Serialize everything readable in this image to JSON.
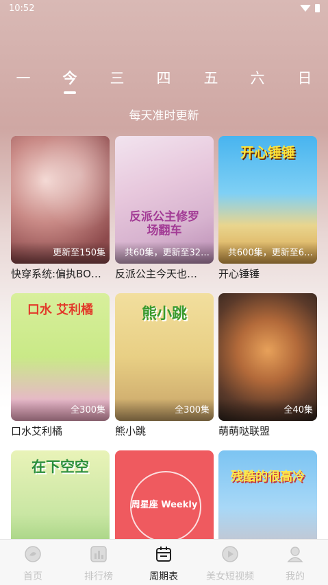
{
  "status": {
    "time": "10:52"
  },
  "days": [
    "一",
    "今",
    "三",
    "四",
    "五",
    "六",
    "日"
  ],
  "subtitle": "每天准时更新",
  "cards": [
    {
      "title": "快穿系统:偏执BO…",
      "badge": "更新至150集",
      "logo": ""
    },
    {
      "title": "反派公主今天也…",
      "badge": "共60集，更新至32…",
      "logo": "反派公主修罗场翻车"
    },
    {
      "title": "开心锤锤",
      "badge": "共600集，更新至6…",
      "logo": "开心锤锤"
    },
    {
      "title": "口水艾利橘",
      "badge": "全300集",
      "logo": "口水 艾利橘"
    },
    {
      "title": "熊小跳",
      "badge": "全300集",
      "logo": "熊小跳"
    },
    {
      "title": "萌萌哒联盟",
      "badge": "全40集",
      "logo": ""
    },
    {
      "title": "",
      "badge": "",
      "logo": "在下空空"
    },
    {
      "title": "",
      "badge": "",
      "logo": "周星座 Weekly"
    },
    {
      "title": "",
      "badge": "",
      "logo": "残酷的很高冷"
    }
  ],
  "tabs": [
    {
      "label": "首页",
      "icon": "home-icon"
    },
    {
      "label": "排行榜",
      "icon": "ranking-icon"
    },
    {
      "label": "周期表",
      "icon": "calendar-icon"
    },
    {
      "label": "美女短视频",
      "icon": "video-icon"
    },
    {
      "label": "我的",
      "icon": "profile-icon"
    }
  ],
  "colors": {
    "active_tab": "#222222",
    "inactive_tab": "#c4c4c4"
  }
}
